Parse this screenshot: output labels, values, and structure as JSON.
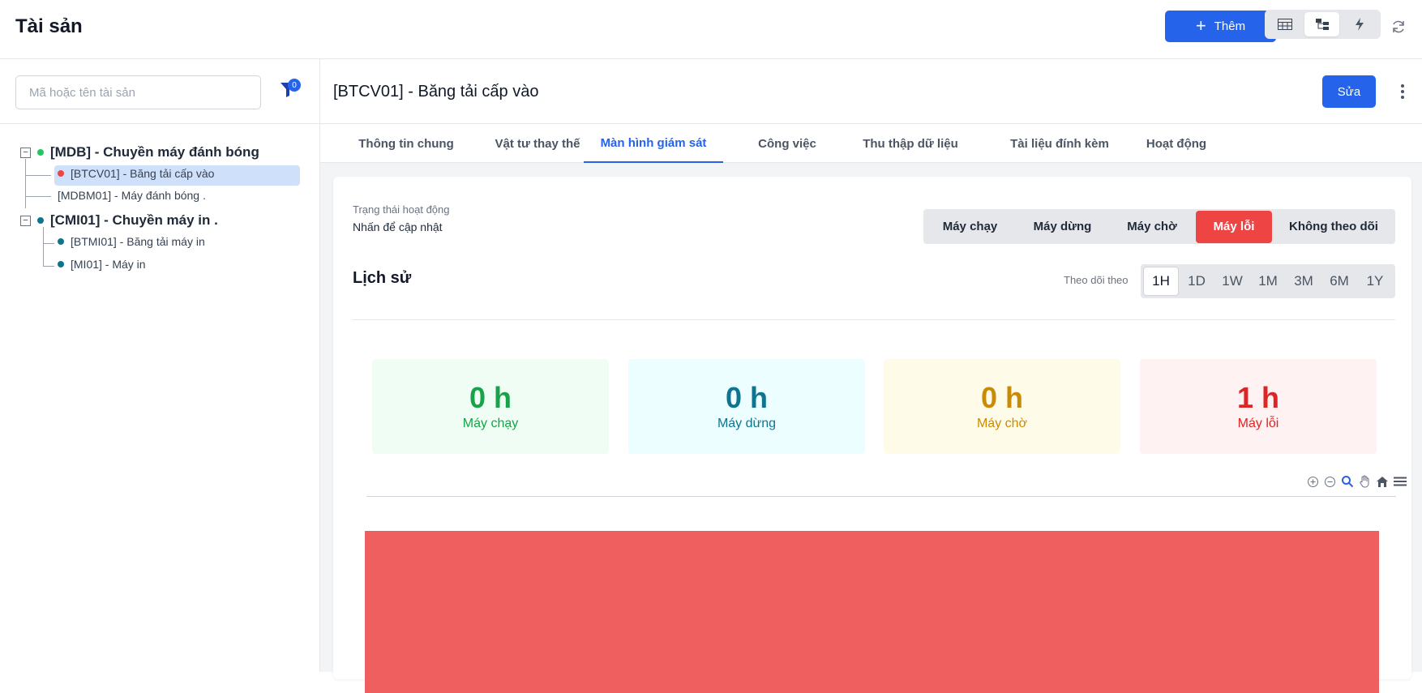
{
  "header": {
    "title": "Tài sản",
    "add_label": "Thêm"
  },
  "sidebar": {
    "search_placeholder": "Mã hoặc tên tài sản",
    "filter_count": "0",
    "tree": [
      {
        "label": "[MDB] - Chuyền máy đánh bóng",
        "status_color": "#22c55e",
        "children": [
          {
            "label": "[BTCV01] - Băng tải cấp vào",
            "status_color": "#ef4444",
            "selected": true
          },
          {
            "label": "[MDBM01] - Máy đánh bóng .",
            "status_color": ""
          }
        ]
      },
      {
        "label": "[CMI01] - Chuyền máy in .",
        "status_color": "#0e7490",
        "children": [
          {
            "label": "[BTMI01] - Băng tải máy in",
            "status_color": "#0e7490"
          },
          {
            "label": "[MI01] - Máy in",
            "status_color": "#0e7490"
          }
        ]
      }
    ]
  },
  "detail": {
    "title": "[BTCV01] - Băng tải cấp vào",
    "edit_label": "Sửa",
    "tabs": [
      "Thông tin chung",
      "Vật tư thay thế",
      "Màn hình giám sát",
      "Công việc",
      "Thu thập dữ liệu",
      "Tài liệu đính kèm",
      "Hoạt động"
    ],
    "active_tab": "Màn hình giám sát",
    "status": {
      "label": "Trạng thái hoạt động",
      "hint": "Nhấn để cập nhật",
      "options": [
        "Máy chạy",
        "Máy dừng",
        "Máy chờ",
        "Máy lỗi",
        "Không theo dõi"
      ],
      "active": "Máy lỗi"
    },
    "history": {
      "title": "Lịch sử",
      "follow_label": "Theo dõi theo",
      "ranges": [
        "1H",
        "1D",
        "1W",
        "1M",
        "3M",
        "6M",
        "1Y"
      ],
      "active_range": "1H"
    },
    "stats": [
      {
        "value": "0 h",
        "label": "Máy chạy",
        "color": "#16a34a",
        "bg": "#f0fdf4"
      },
      {
        "value": "0 h",
        "label": "Máy dừng",
        "color": "#0e7490",
        "bg": "#ecfeff"
      },
      {
        "value": "0 h",
        "label": "Máy chờ",
        "color": "#ca8a04",
        "bg": "#fefce8"
      },
      {
        "value": "1 h",
        "label": "Máy lỗi",
        "color": "#dc2626",
        "bg": "#fef2f2"
      }
    ],
    "chart_bar_color": "#ef5f5f"
  }
}
